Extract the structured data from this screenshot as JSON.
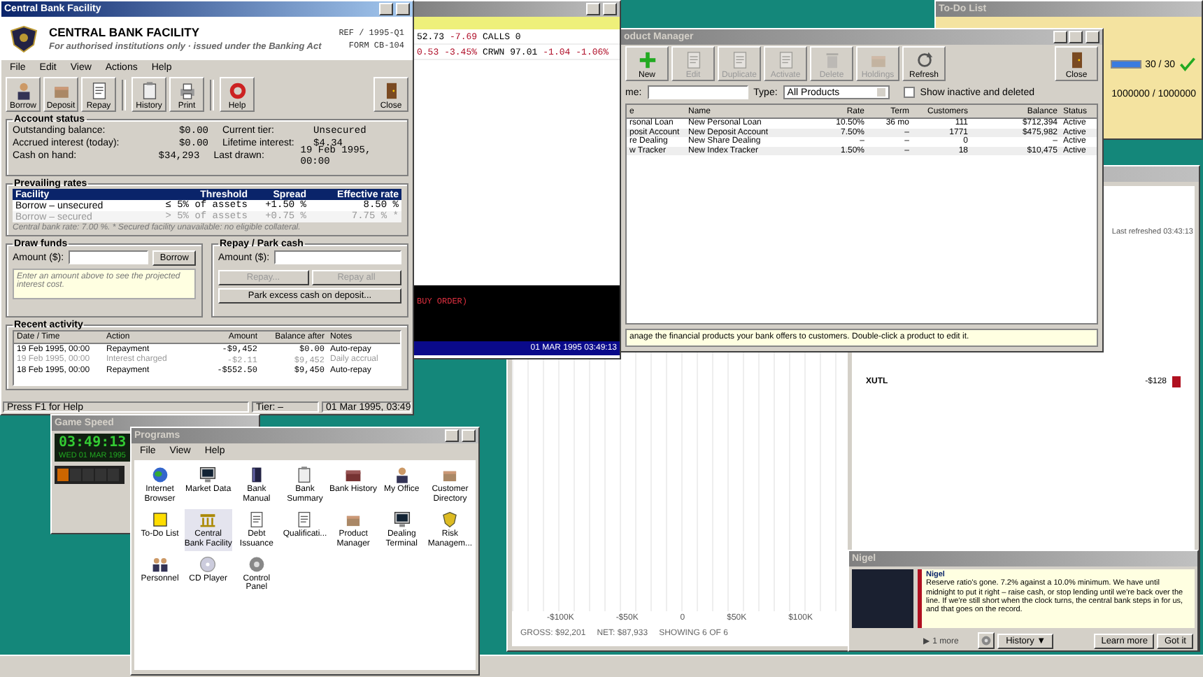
{
  "central_bank": {
    "title": "Central Bank Facility",
    "header": {
      "name": "CENTRAL BANK FACILITY",
      "subtitle": "For authorised institutions only · issued under the Banking Act",
      "ref": "REF / 1995-Q1",
      "form": "FORM CB-104"
    },
    "menu": [
      "File",
      "Edit",
      "View",
      "Actions",
      "Help"
    ],
    "toolbar": [
      {
        "label": "Borrow",
        "separator_before": false
      },
      {
        "label": "Deposit",
        "separator_before": false
      },
      {
        "label": "Repay",
        "separator_before": false
      },
      {
        "label": "History",
        "separator_before": true
      },
      {
        "label": "Print",
        "separator_before": false
      },
      {
        "label": "Help",
        "separator_before": true
      }
    ],
    "close": "Close",
    "account_status": {
      "title": "Account status",
      "rows": [
        {
          "label": "Outstanding balance:",
          "value": "$0.00",
          "label2": "Current tier:",
          "value2": "Unsecured"
        },
        {
          "label": "Accrued interest (today):",
          "value": "$0.00",
          "label2": "Lifetime interest:",
          "value2": "$4.34"
        },
        {
          "label": "Cash on hand:",
          "value": "$34,293",
          "label2": "Last drawn:",
          "value2": "19 Feb 1995, 00:00"
        }
      ]
    },
    "rates": {
      "title": "Prevailing rates",
      "columns": [
        "Facility",
        "Threshold",
        "Spread",
        "Effective rate"
      ],
      "rows": [
        {
          "cells": [
            "Borrow – unsecured",
            "≤ 5% of assets",
            "+1.50 %",
            "8.50 %"
          ],
          "disabled": false
        },
        {
          "cells": [
            "Borrow – secured",
            "> 5% of assets",
            "+0.75 %",
            "7.75 % *"
          ],
          "disabled": true
        }
      ],
      "note": "Central bank rate: 7.00 %.   * Secured facility unavailable: no eligible collateral."
    },
    "draw_funds": {
      "title": "Draw funds",
      "amount_label": "Amount ($):",
      "button": "Borrow",
      "hint": "Enter an amount above to see the projected interest cost."
    },
    "repay": {
      "title": "Repay / Park cash",
      "amount_label": "Amount ($):",
      "buttons": [
        {
          "label": "Repay...",
          "disabled": true
        },
        {
          "label": "Repay all",
          "disabled": true
        },
        {
          "label": "Park excess cash on deposit...",
          "disabled": false
        }
      ]
    },
    "activity": {
      "title": "Recent activity",
      "columns": [
        "Date / Time",
        "Action",
        "Amount",
        "Balance after",
        "Notes"
      ],
      "rows": [
        {
          "cells": [
            "19 Feb 1995, 00:00",
            "Repayment",
            "-$9,452",
            "$0.00",
            "Auto-repay"
          ],
          "dimmed": false
        },
        {
          "cells": [
            "19 Feb 1995, 00:00",
            "Interest charged",
            "-$2.11",
            "$9,452",
            "Daily accrual"
          ],
          "dimmed": true
        },
        {
          "cells": [
            "18 Feb 1995, 00:00",
            "Repayment",
            "-$552.50",
            "$9,450",
            "Auto-repay"
          ],
          "dimmed": false
        }
      ]
    },
    "status_bar": [
      "Press F1 for Help",
      "Tier: –",
      "01 Mar 1995, 03:49"
    ]
  },
  "dealing_terminal": {
    "quotes": [
      [
        {
          "text": "52.73",
          "negative": false
        },
        {
          "text": "-7.69",
          "negative": true
        },
        {
          "text": "CALLS 0",
          "negative": false
        }
      ],
      [
        {
          "text": "0.53",
          "negative": true
        },
        {
          "text": "-3.45%",
          "negative": true
        },
        {
          "text": "CRWN",
          "negative": false
        },
        {
          "text": "97.01",
          "negative": false
        },
        {
          "text": "-1.04",
          "negative": true
        },
        {
          "text": "-1.06%",
          "negative": true
        }
      ]
    ],
    "order_text": "BUY ORDER)",
    "timestamp": "01 MAR 1995 03:49:13"
  },
  "product_manager": {
    "title": "oduct Manager",
    "toolbar": [
      {
        "label": "New",
        "disabled": false
      },
      {
        "label": "Edit",
        "disabled": true
      },
      {
        "label": "Duplicate",
        "disabled": true
      },
      {
        "label": "Activate",
        "disabled": true
      },
      {
        "label": "Delete",
        "disabled": true
      },
      {
        "label": "Holdings",
        "disabled": true
      },
      {
        "label": "Refresh",
        "disabled": false
      }
    ],
    "close": "Close",
    "filter_label": "me:",
    "type_label": "Type:",
    "type_value": "All Products",
    "show_inactive": {
      "label": "Show inactive and deleted",
      "checked": false
    },
    "columns": [
      "e",
      "Name",
      "Rate",
      "Term",
      "Customers",
      "Balance",
      "Status"
    ],
    "rows": [
      [
        "rsonal Loan",
        "New Personal Loan",
        "10.50%",
        "36 mo",
        "111",
        "$712,394",
        "Active"
      ],
      [
        "posit Account",
        "New Deposit Account",
        "7.50%",
        "–",
        "1771",
        "$475,982",
        "Active"
      ],
      [
        "re Dealing",
        "New Share Dealing",
        "–",
        "–",
        "0",
        "–",
        "Active"
      ],
      [
        "w Tracker",
        "New Index Tracker",
        "1.50%",
        "–",
        "18",
        "$10,475",
        "Active"
      ]
    ],
    "hint": "anage the financial products your bank offers to customers. Double-click a product to edit it."
  },
  "todo_list": {
    "title": "To-Do List",
    "items": [
      {
        "reading": "30 / 30",
        "level": 1
      },
      {
        "reading": "1000000 / 1000000"
      }
    ]
  },
  "chart_window": {
    "last_refreshed": "Last refreshed 03:43:13",
    "axis_labels": [
      "-$100K",
      "-$50K",
      "0",
      "$50K",
      "$100K"
    ],
    "footer": [
      "GROSS: $92,201",
      "NET: $87,933",
      "SHOWING 6 OF 6"
    ],
    "holding": {
      "name": "XUTL",
      "value": "-$128"
    }
  },
  "game_speed": {
    "title": "Game Speed",
    "clock": "03:49:13",
    "date": "WED 01 MAR 1995",
    "speeds": [
      {
        "selected": true
      },
      {
        "selected": false
      },
      {
        "selected": false
      },
      {
        "selected": false
      },
      {
        "selected": false
      }
    ]
  },
  "programs": {
    "title": "Programs",
    "menu": [
      "File",
      "View",
      "Help"
    ],
    "items": [
      {
        "label": "Internet Browser",
        "selected": false
      },
      {
        "label": "Market Data",
        "selected": false
      },
      {
        "label": "Bank Manual",
        "selected": false
      },
      {
        "label": "Bank Summary",
        "selected": false
      },
      {
        "label": "Bank History",
        "selected": false
      },
      {
        "label": "My Office",
        "selected": false
      },
      {
        "label": "Customer Directory",
        "selected": false
      },
      {
        "label": "To-Do List",
        "selected": false
      },
      {
        "label": "Central Bank Facility",
        "selected": true
      },
      {
        "label": "Debt Issuance",
        "selected": false
      },
      {
        "label": "Qualificati...",
        "selected": false
      },
      {
        "label": "Product Manager",
        "selected": false
      },
      {
        "label": "Dealing Terminal",
        "selected": false
      },
      {
        "label": "Risk Managem...",
        "selected": false
      },
      {
        "label": "Personnel",
        "selected": false
      },
      {
        "label": "CD Player",
        "selected": false
      },
      {
        "label": "Control Panel",
        "selected": false
      }
    ]
  },
  "advisor": {
    "title": "Nigel",
    "name": "Nigel",
    "message": "Reserve ratio's gone. 7.2% against a 10.0% minimum. We have until midnight to put it right – raise cash, or stop lending until we're back over the line. If we're still short when the clock turns, the central bank steps in for us, and that goes on the record.",
    "more": "▶ 1 more",
    "buttons": [
      "History ▼",
      "Learn more",
      "Got it"
    ]
  }
}
